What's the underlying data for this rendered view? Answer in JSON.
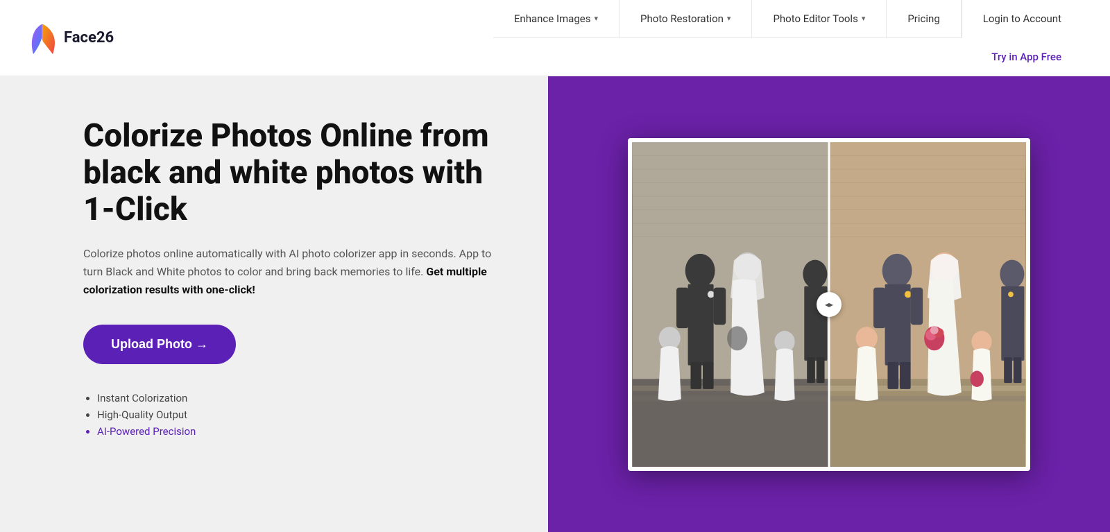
{
  "header": {
    "logo_text": "Face26",
    "nav_items": [
      {
        "id": "enhance-images",
        "label": "Enhance Images",
        "has_dropdown": true
      },
      {
        "id": "photo-restoration",
        "label": "Photo Restoration",
        "has_dropdown": true
      },
      {
        "id": "photo-editor-tools",
        "label": "Photo Editor Tools",
        "has_dropdown": true
      },
      {
        "id": "pricing",
        "label": "Pricing",
        "has_dropdown": false
      },
      {
        "id": "login",
        "label": "Login to Account",
        "has_dropdown": false
      }
    ],
    "try_label": "Try in App Free"
  },
  "hero": {
    "title": "Colorize Photos Online from black and white photos with 1-Click",
    "description_plain": "Colorize photos online automatically with AI photo colorizer app in seconds. App to turn Black and White photos to color and bring back memories to life.",
    "description_bold": "Get multiple colorization results with one-click!",
    "upload_button": "Upload Photo →",
    "features": [
      "Instant Colorization",
      "High-Quality Output",
      "AI-Powered Precision"
    ]
  },
  "colors": {
    "brand_purple": "#5b21b6",
    "bg_right": "#6b21a8",
    "text_dark": "#111111",
    "text_gray": "#555555"
  }
}
